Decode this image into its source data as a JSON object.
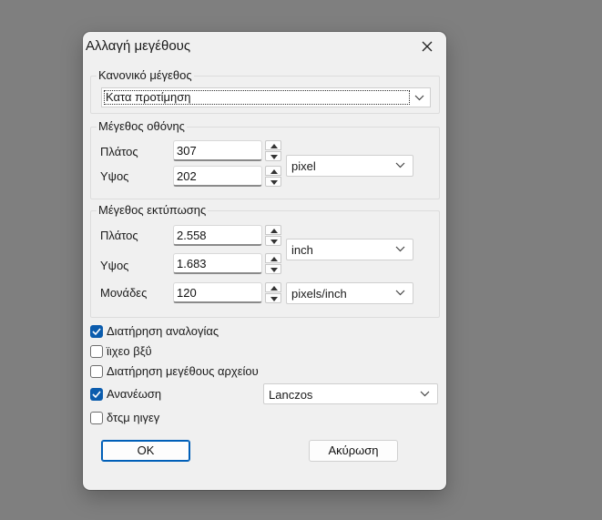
{
  "dialog": {
    "title": "Αλλαγή μεγέθους",
    "close_icon": "close-icon"
  },
  "preset_group": {
    "title": "Κανονικό μέγεθος",
    "selected": "Κατα προτίμηση"
  },
  "screen_group": {
    "title": "Μέγεθος οθόνης",
    "width_label": "Πλάτος",
    "width_value": "307",
    "height_label": "Υψος",
    "height_value": "202",
    "unit": "pixel"
  },
  "print_group": {
    "title": "Μέγεθος εκτύπωσης",
    "width_label": "Πλάτος",
    "width_value": "2.558",
    "height_label": "Υψος",
    "height_value": "1.683",
    "size_unit": "inch",
    "units_label": "Μονάδες",
    "units_value": "120",
    "resolution_unit": "pixels/inch"
  },
  "options": {
    "keep_ratio": {
      "label": "Διατήρηση αναλογίας",
      "checked": true
    },
    "option2": {
      "label": "ϊιχεο βξΰ",
      "checked": false
    },
    "keep_filesize": {
      "label": "Διατήρηση μεγέθους αρχείου",
      "checked": false
    },
    "resample": {
      "label": "Ανανέωση",
      "checked": true,
      "method": "Lanczos"
    },
    "option5": {
      "label": "δτςμ ηιγεγ",
      "checked": false
    }
  },
  "buttons": {
    "ok": "OK",
    "cancel": "Ακύρωση"
  },
  "colors": {
    "accent": "#0b5cad",
    "backdrop": "#7f7f7f",
    "dialog_bg": "#f0f0f0"
  }
}
